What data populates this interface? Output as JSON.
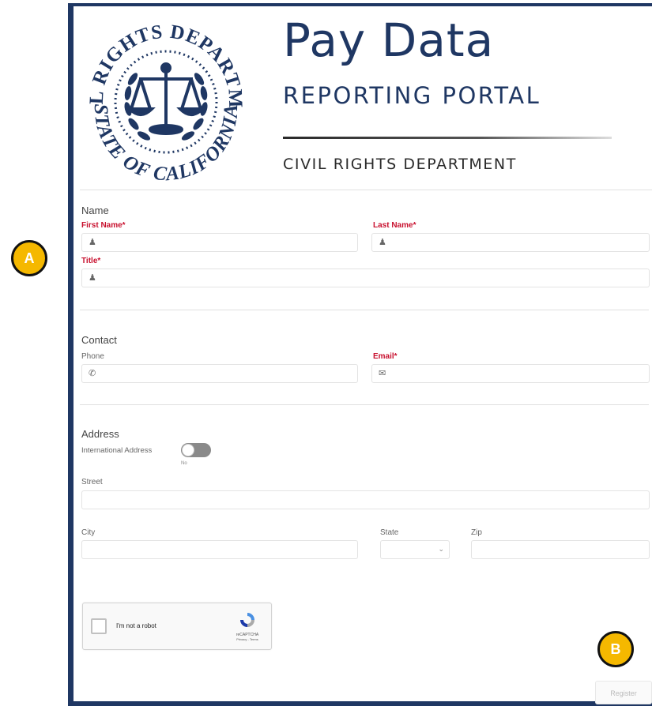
{
  "seal": {
    "top_text": "CIVIL RIGHTS DEPARTMENT",
    "bottom_text": "STATE OF CALIFORNIA"
  },
  "header": {
    "title": "Pay Data",
    "subtitle": "REPORTING PORTAL",
    "department": "CIVIL RIGHTS DEPARTMENT",
    "brand_color": "#1f3763"
  },
  "name_section": {
    "title": "Name",
    "first_name_label": "First Name*",
    "last_name_label": "Last Name*",
    "title_label": "Title*",
    "icon": "person-icon"
  },
  "contact_section": {
    "title": "Contact",
    "phone_label": "Phone",
    "email_label": "Email*",
    "phone_icon": "phone-icon",
    "email_icon": "envelope-icon"
  },
  "address_section": {
    "title": "Address",
    "international_label": "International Address",
    "international_state": "No",
    "street_label": "Street",
    "city_label": "City",
    "state_label": "State",
    "zip_label": "Zip"
  },
  "recaptcha": {
    "label": "I'm not a robot",
    "brand": "reCAPTCHA",
    "links": "Privacy - Terms"
  },
  "register_label": "Register",
  "callouts": {
    "a": "A",
    "b": "B",
    "color": "#f5b800"
  },
  "required_color": "#c8102e"
}
